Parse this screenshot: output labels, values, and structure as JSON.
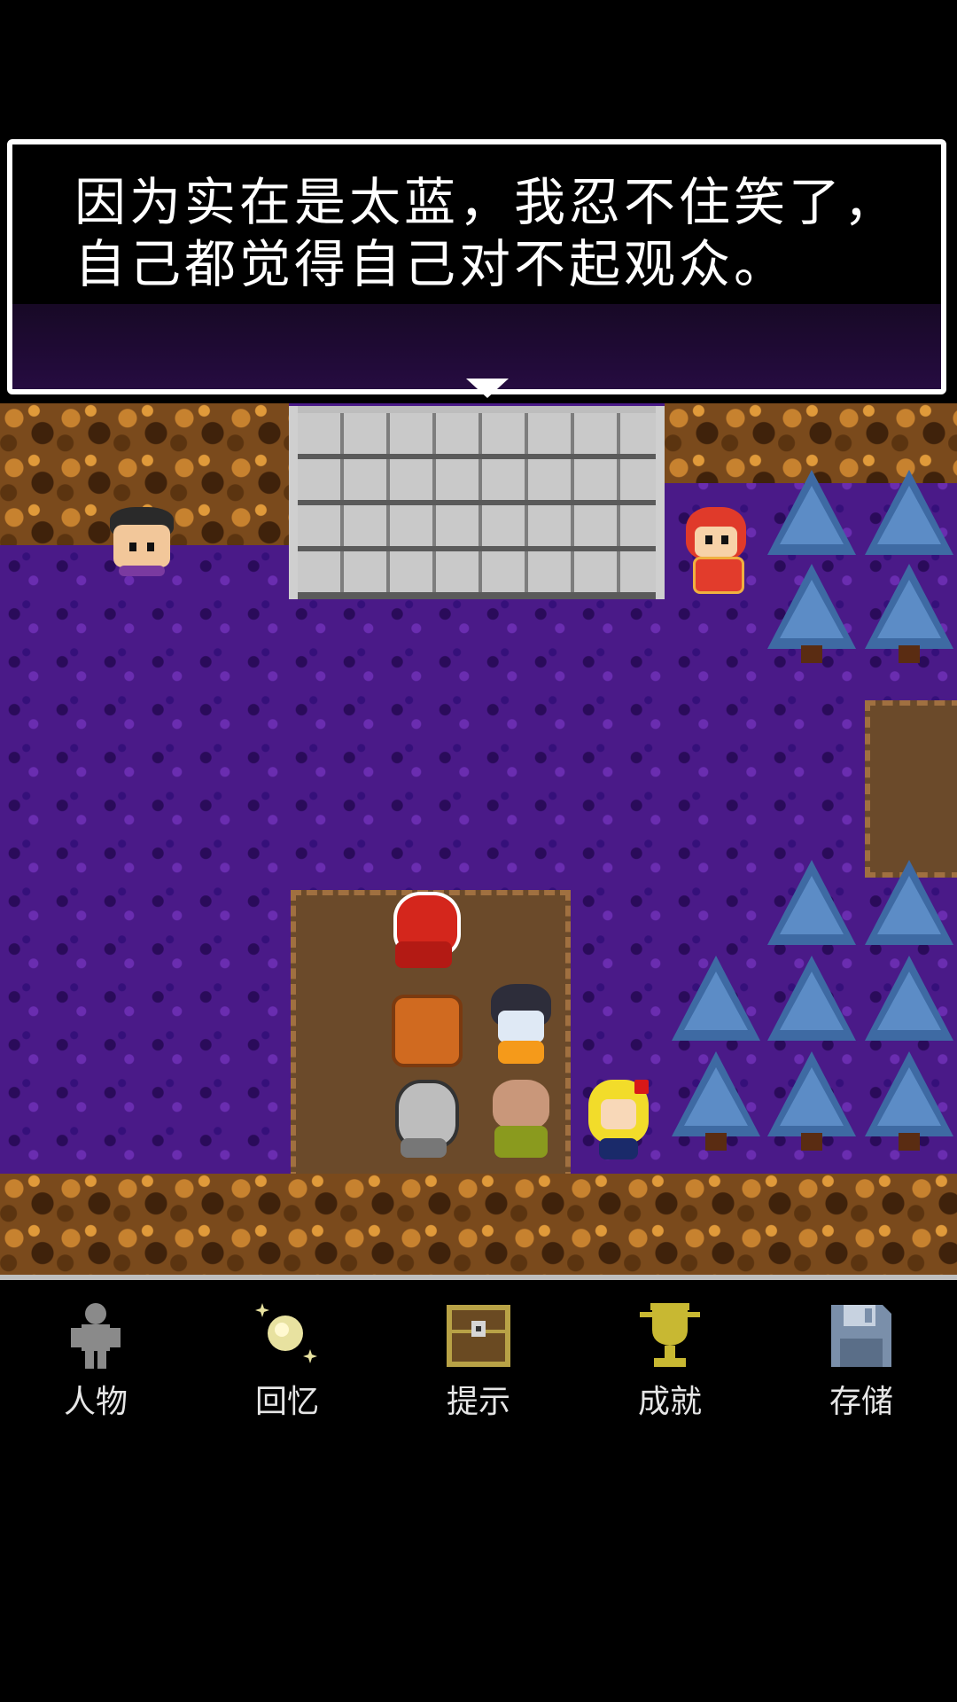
{
  "dialog": {
    "line1": "因为实在是太蓝，我忍不住笑了，",
    "line2": "自己都觉得自己对不起观众。"
  },
  "menu": {
    "characters": "人物",
    "memories": "回忆",
    "hints": "提示",
    "achievements": "成就",
    "save": "存储"
  },
  "colors": {
    "ground": "#4a1a88",
    "dialog_border": "#ffffff",
    "tree": "#3e6aa3",
    "rock": "#7a4a1c"
  },
  "icons": {
    "characters": "person-silhouette-icon",
    "memories": "sparkle-orb-icon",
    "hints": "treasure-chest-icon",
    "achievements": "trophy-icon",
    "save": "floppy-disk-icon"
  }
}
